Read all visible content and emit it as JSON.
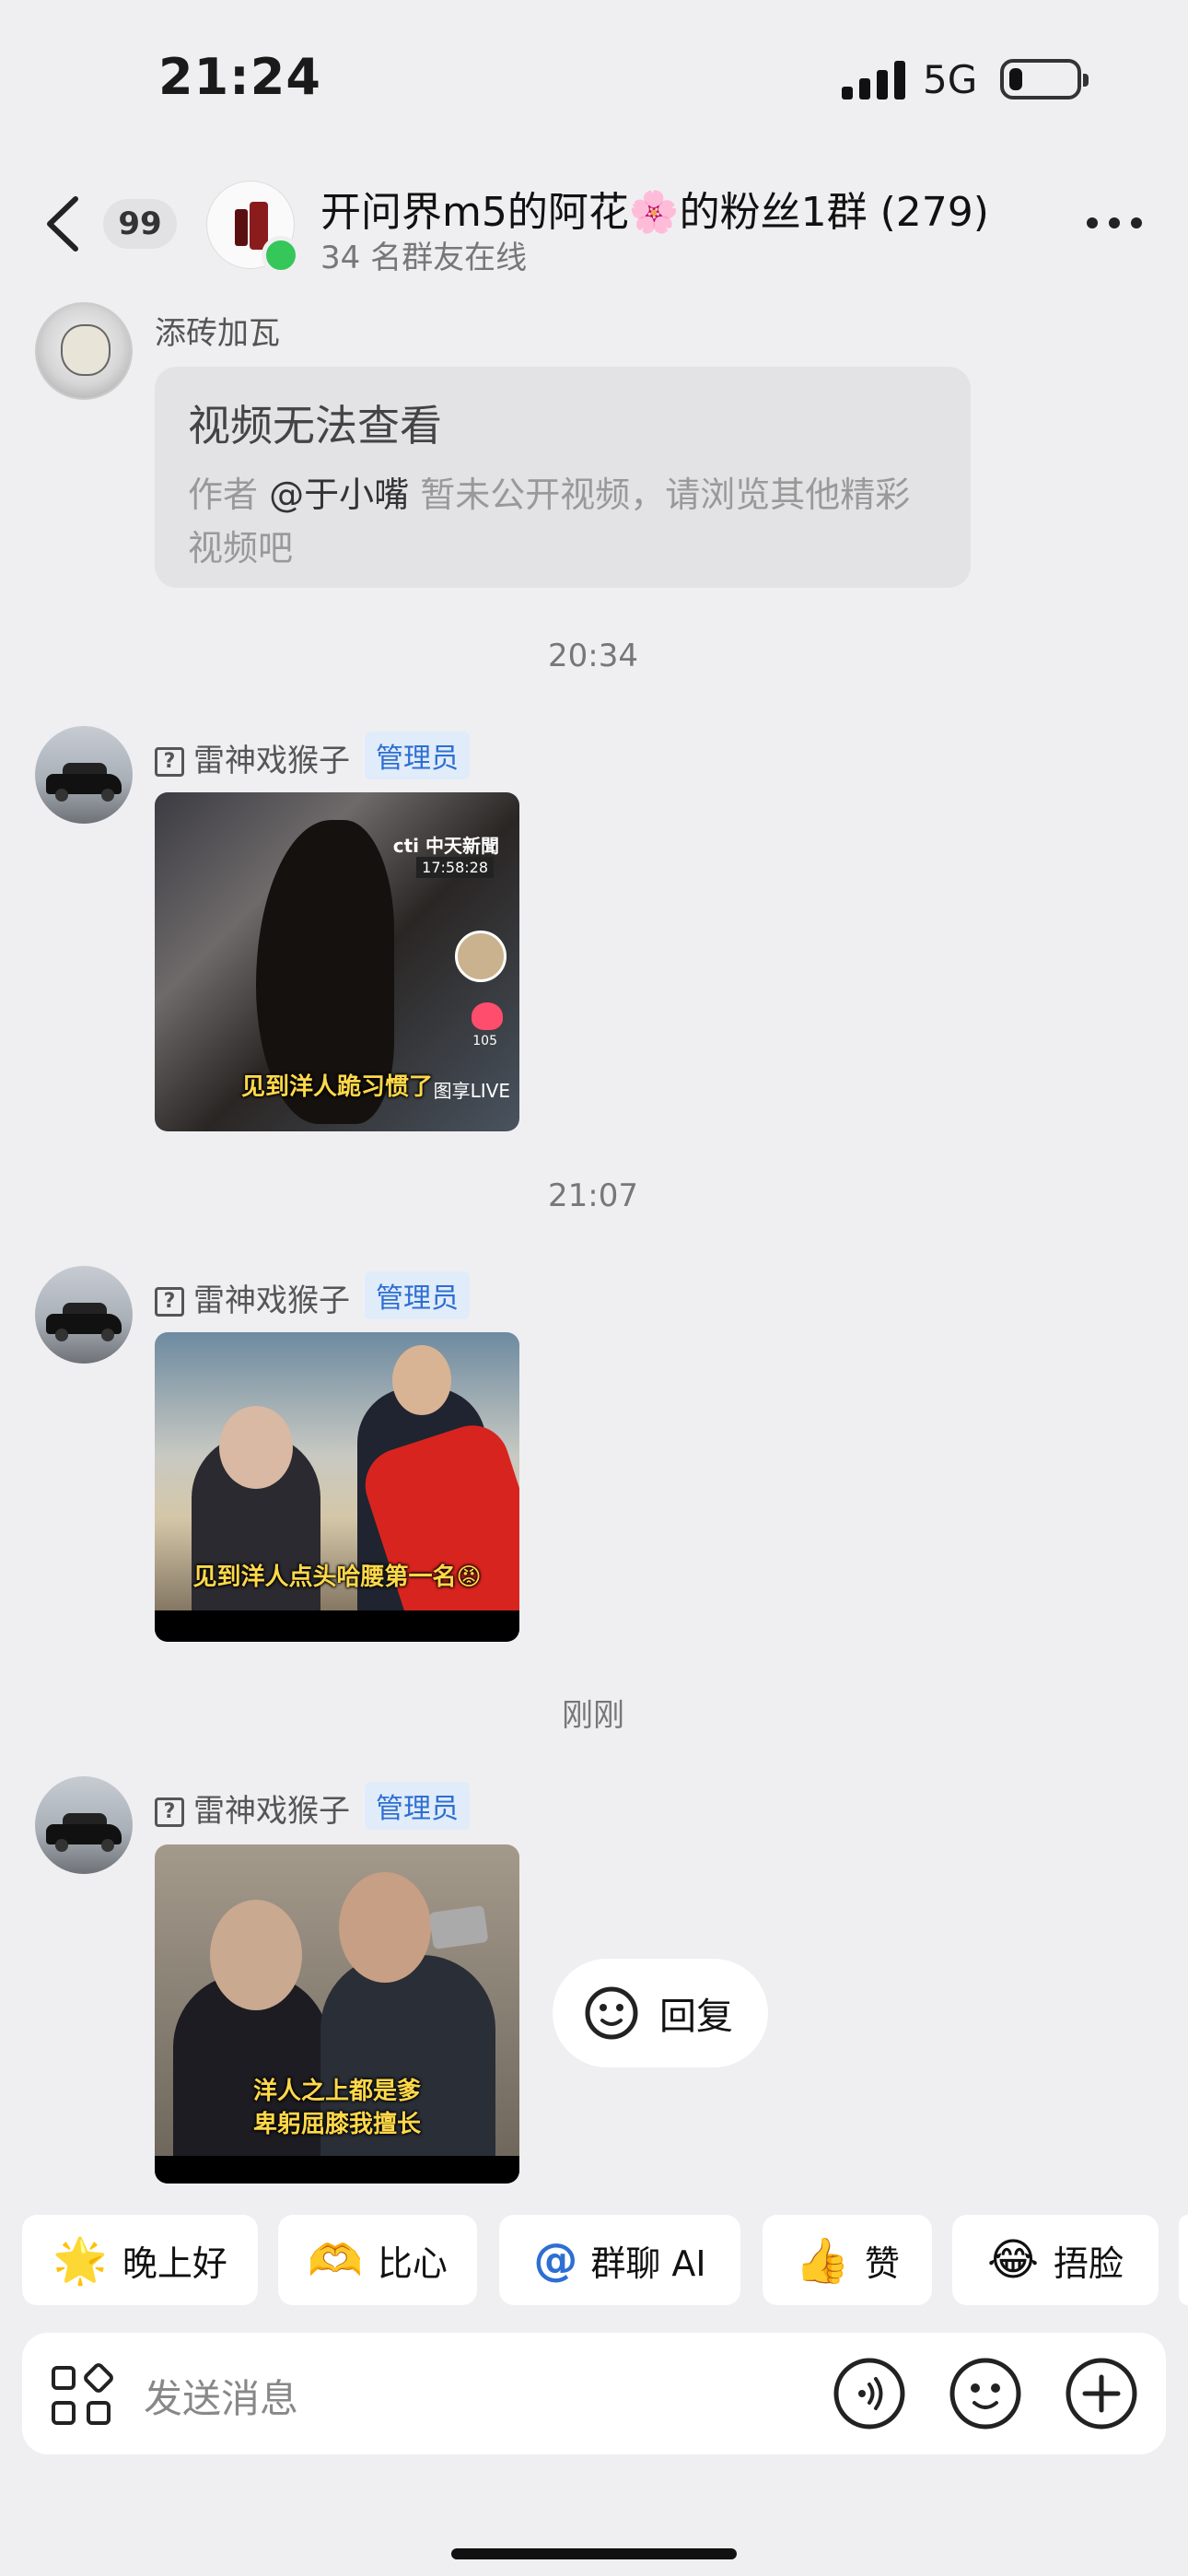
{
  "status_bar": {
    "time": "21:24",
    "network": "5G"
  },
  "header": {
    "unread_count": "99",
    "group_title": "开问界m5的阿花🌸的粉丝1群 (279)",
    "online_text": "34 名群友在线"
  },
  "messages": [
    {
      "sender": "添砖加瓦",
      "card": {
        "title": "视频无法查看",
        "desc_prefix": "作者 ",
        "mention": "@于小嘴",
        "desc_suffix": " 暂未公开视频，请浏览其他精彩视频吧"
      }
    },
    {
      "time": "20:34",
      "sender": "雷神戏猴子",
      "badge": "管理员",
      "thumb": {
        "logo": "cti 中天新聞",
        "clock": "17:58:28",
        "likes": "105",
        "caption": "见到洋人跪习惯了",
        "corner": "图享LIVE"
      }
    },
    {
      "time": "21:07",
      "sender": "雷神戏猴子",
      "badge": "管理员",
      "thumb": {
        "caption": "见到洋人点头哈腰第一名😡"
      }
    },
    {
      "time": "刚刚",
      "sender": "雷神戏猴子",
      "badge": "管理员",
      "thumb": {
        "caption_line1": "洋人之上都是爹",
        "caption_line2": "卑躬屈膝我擅长"
      }
    }
  ],
  "reply_label": "回复",
  "quick_replies": [
    {
      "emoji": "🌟",
      "label": "晚上好"
    },
    {
      "emoji": "🫶",
      "label": "比心"
    },
    {
      "emoji": "@",
      "label": "群聊 AI"
    },
    {
      "emoji": "👍",
      "label": "赞"
    },
    {
      "emoji": "😂",
      "label": "捂脸"
    }
  ],
  "input": {
    "placeholder": "发送消息"
  }
}
